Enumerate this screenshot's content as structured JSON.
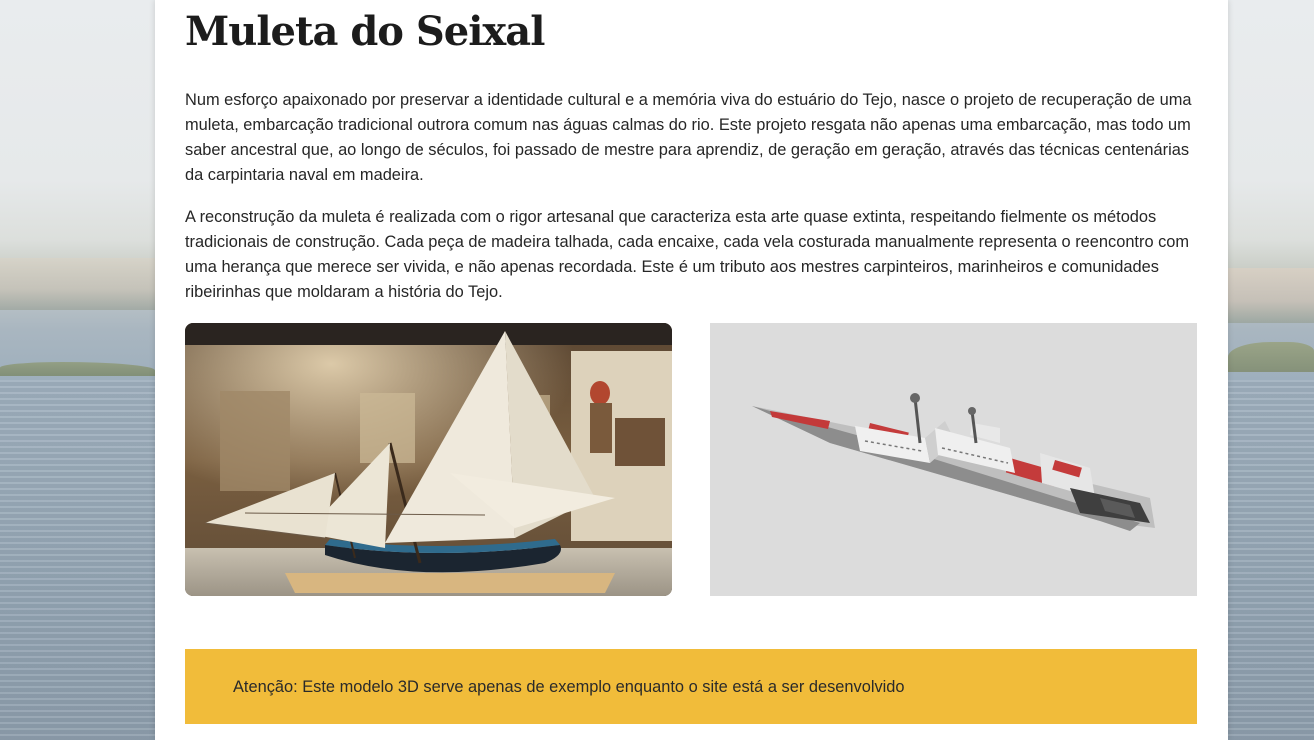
{
  "page": {
    "title": "Muleta do Seixal",
    "paragraphs": [
      "Num esforço apaixonado por preservar a identidade cultural e a memória viva do estuário do Tejo, nasce o projeto de recuperação de uma muleta, embarcação tradicional outrora comum nas águas calmas do rio. Este projeto resgata não apenas uma embarcação, mas todo um saber ancestral que, ao longo de séculos, foi passado de mestre para aprendiz, de geração em geração, através das técnicas centenárias da carpintaria naval em madeira.",
      "A reconstrução da muleta é realizada com o rigor artesanal que caracteriza esta arte quase extinta, respeitando fielmente os métodos tradicionais de construção. Cada peça de madeira talhada, cada encaixe, cada vela costurada manualmente representa o reencontro com uma herança que merece ser vivida, e não apenas recordada. Este é um tributo aos mestres carpinteiros, marinheiros e comunidades ribeirinhas que moldaram a história do Tejo."
    ],
    "notice": "Atenção: Este modelo 3D serve apenas de exemplo enquanto o site está a ser desenvolvido"
  },
  "images": {
    "left": "photo-muleta-model-exhibition",
    "right": "3d-model-viewer-ship"
  },
  "colors": {
    "notice_bg": "#f1bc3a",
    "card_bg": "#ffffff",
    "viewer_bg": "#dcdcdc",
    "text": "#262626"
  }
}
